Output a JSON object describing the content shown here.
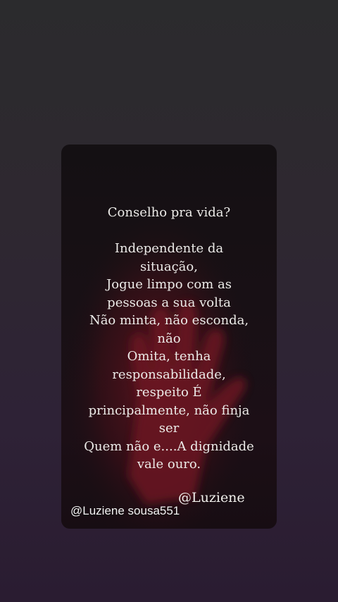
{
  "quote": {
    "title": "Conselho pra vida?",
    "lines": [
      "Independente da",
      "situação,",
      "Jogue limpo com as",
      "pessoas a sua volta",
      "Não minta, não esconda,",
      "não",
      "Omita, tenha",
      "responsabilidade,",
      "respeito É",
      "principalmente, não finja",
      "ser",
      "Quem não e....A dignidade",
      "vale ouro."
    ],
    "signature": "@Luziene"
  },
  "watermark": "@Luziene sousa551",
  "colors": {
    "background_top": "#2b2b2d",
    "background_bottom": "#2a1c31",
    "card": "#160f14",
    "hand": "#6a1420",
    "text": "#ecebe8"
  }
}
